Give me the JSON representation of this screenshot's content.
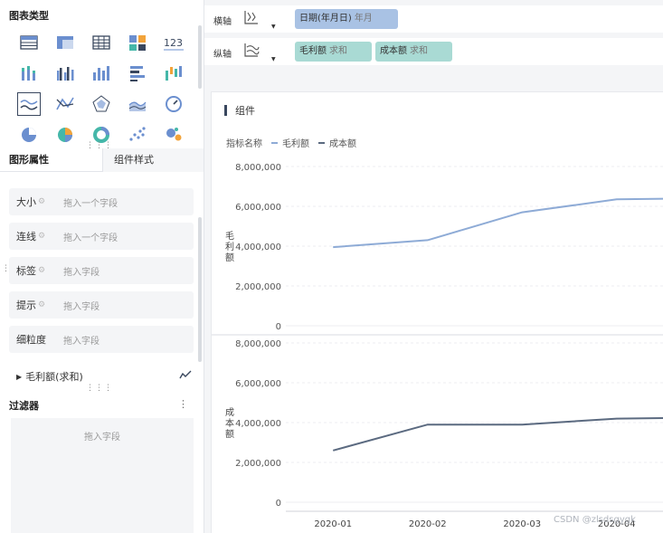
{
  "left_panel": {
    "chart_types_title": "图表类型",
    "chart_type_icons": [
      "table-icon",
      "pivot-table-icon",
      "detail-table-icon",
      "card-grid-icon",
      "kpi-number-icon",
      "stacked-column-icon",
      "grouped-column-icon",
      "column-icon",
      "horizontal-bar-icon",
      "waterfall-icon",
      "multi-line-icon",
      "line-icon",
      "radar-icon",
      "area-icon",
      "gauge-icon",
      "pie-icon",
      "donut-pie-icon",
      "ring-icon",
      "scatter-icon",
      "bubble-icon"
    ],
    "selected_chart_type_index": 10,
    "tabs": {
      "shape_props": "图形属性",
      "component_style": "组件样式"
    },
    "fields": [
      {
        "label": "大小",
        "placeholder": "拖入一个字段",
        "has_gear": true
      },
      {
        "label": "连线",
        "placeholder": "拖入一个字段",
        "has_gear": true
      },
      {
        "label": "标签",
        "placeholder": "拖入字段",
        "has_gear": true
      },
      {
        "label": "提示",
        "placeholder": "拖入字段",
        "has_gear": true
      },
      {
        "label": "细粒度",
        "placeholder": "拖入字段",
        "has_gear": false
      }
    ],
    "measure_item": "毛利额(求和)",
    "filter": {
      "title": "过滤器",
      "more": "⋮",
      "placeholder": "拖入字段"
    }
  },
  "axes": {
    "x_axis": {
      "label": "横轴",
      "pills": [
        {
          "name": "日期(年月日)",
          "agg": "年月",
          "color": "blue"
        }
      ]
    },
    "y_axis": {
      "label": "纵轴",
      "pills": [
        {
          "name": "毛利额",
          "agg": "求和",
          "color": "teal"
        },
        {
          "name": "成本额",
          "agg": "求和",
          "color": "teal"
        }
      ]
    }
  },
  "component": {
    "title": "组件",
    "legend_title": "指标名称",
    "legend_items": [
      {
        "name": "毛利额",
        "color": "#8eabd6"
      },
      {
        "name": "成本额",
        "color": "#5b6a80"
      }
    ]
  },
  "colors": {
    "series1": "#8eabd6",
    "series2": "#5b6a80",
    "accent": "#39475e"
  },
  "chart_data": [
    {
      "type": "line",
      "categories": [
        "2020-01",
        "2020-02",
        "2020-03",
        "2020-04"
      ],
      "series": [
        {
          "name": "毛利额",
          "values": [
            3950000,
            4300000,
            5700000,
            6350000
          ]
        }
      ],
      "ylabel": "毛利额",
      "ylim": [
        0,
        8000000
      ],
      "yticks": [
        "8,000,000",
        "6,000,000",
        "4,000,000",
        "2,000,000",
        "0"
      ],
      "grid": true
    },
    {
      "type": "line",
      "categories": [
        "2020-01",
        "2020-02",
        "2020-03",
        "2020-04"
      ],
      "series": [
        {
          "name": "成本额",
          "values": [
            2600000,
            3900000,
            3900000,
            4200000
          ]
        }
      ],
      "ylabel": "成本额",
      "ylim": [
        0,
        8000000
      ],
      "yticks": [
        "8,000,000",
        "6,000,000",
        "4,000,000",
        "2,000,000",
        "0"
      ],
      "xticks": [
        "2020-01",
        "2020-02",
        "2020-03",
        "2020-04"
      ],
      "grid": true
    }
  ],
  "watermark": "CSDN @zlsdsgygk"
}
